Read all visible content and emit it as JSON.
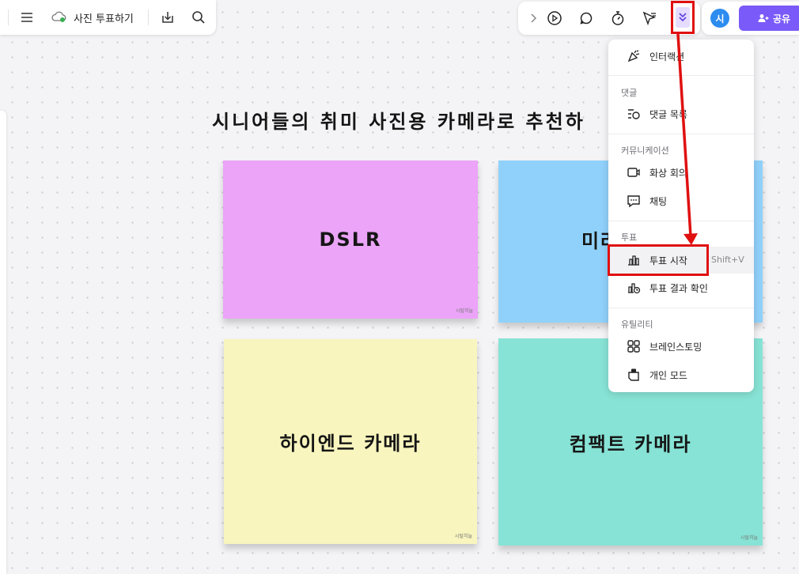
{
  "toolbar_left": {
    "menu_icon": "hamburger-menu-icon",
    "cloud_icon": "cloud-saved-icon",
    "board_title": "사진 투표하기",
    "download_icon": "download-icon",
    "search_icon": "search-icon"
  },
  "toolbar_right": {
    "icons": [
      "chevron-right-icon",
      "play-icon",
      "comment-icon",
      "timer-icon",
      "cursor-flag-icon",
      "double-chevron-down-icon"
    ],
    "avatar_initial": "시",
    "share_label": "공유"
  },
  "board": {
    "heading": "시니어들의 취미 사진용 카메라로 추천하",
    "notes": [
      {
        "label": "DSLR",
        "author": "시털히늘",
        "color": "#eba4f7"
      },
      {
        "label": "미러",
        "author": "",
        "color": "#90d1fb"
      },
      {
        "label": "하이엔드 카메라",
        "author": "시털히늘",
        "color": "#f8f5be"
      },
      {
        "label": "컴팩트 카메라",
        "author": "시털히늘",
        "color": "#87e3d5"
      }
    ]
  },
  "dropdown": {
    "interaction": "인터랙션",
    "sec_comment": "댓글",
    "comment_list": "댓글 목록",
    "sec_communication": "커뮤니케이션",
    "video_call": "화상 회의",
    "chat": "채팅",
    "sec_poll": "투표",
    "poll_start": "투표 시작",
    "poll_shortcut": "Shift+V",
    "poll_result": "투표 결과 확인",
    "sec_utility": "유틸리티",
    "brainstorm": "브레인스토밍",
    "private_mode": "개인 모드"
  },
  "colors": {
    "accent": "#7a5af8",
    "highlight": "#e01010",
    "avatar": "#2d8cf0"
  }
}
